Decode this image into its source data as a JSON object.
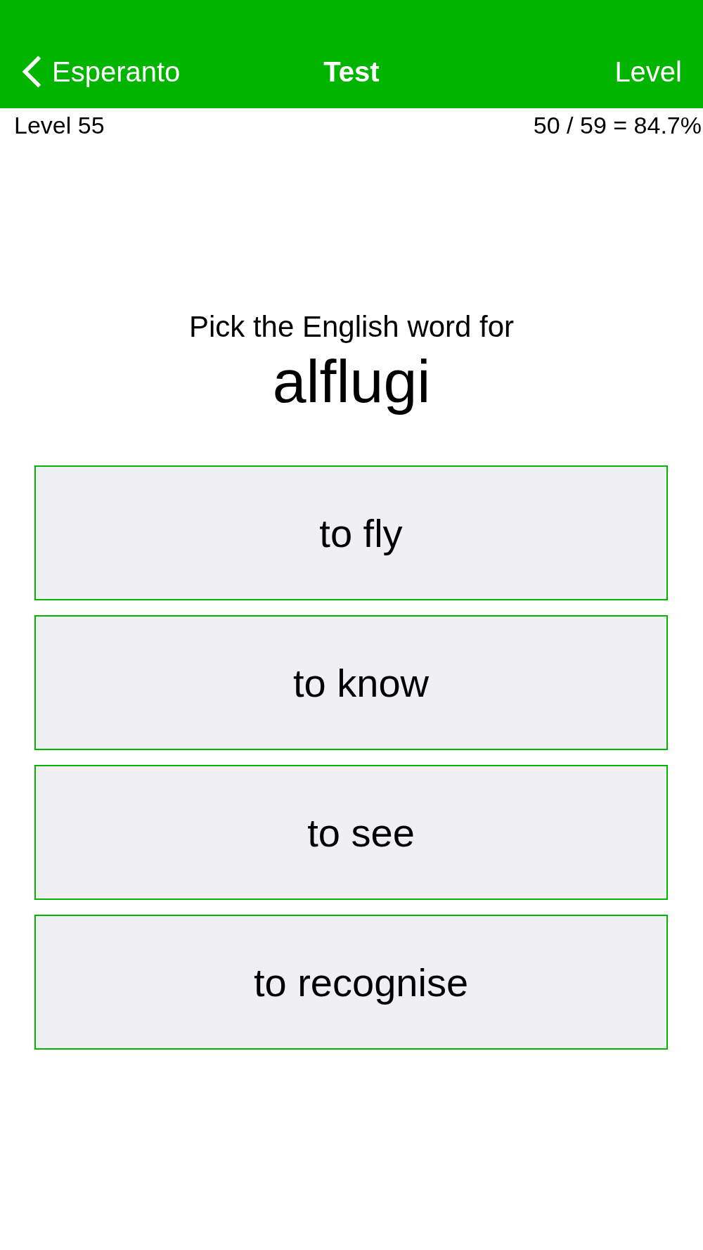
{
  "nav_bar": {
    "back_label": "Esperanto",
    "title": "Test",
    "right_button": "Level"
  },
  "status": {
    "level": "Level 55",
    "score": "50 / 59 = 84.7%"
  },
  "question": {
    "prompt": "Pick the English word for",
    "word": "alflugi"
  },
  "answers": [
    {
      "label": "to fly"
    },
    {
      "label": "to know"
    },
    {
      "label": "to see"
    },
    {
      "label": "to recognise"
    }
  ]
}
